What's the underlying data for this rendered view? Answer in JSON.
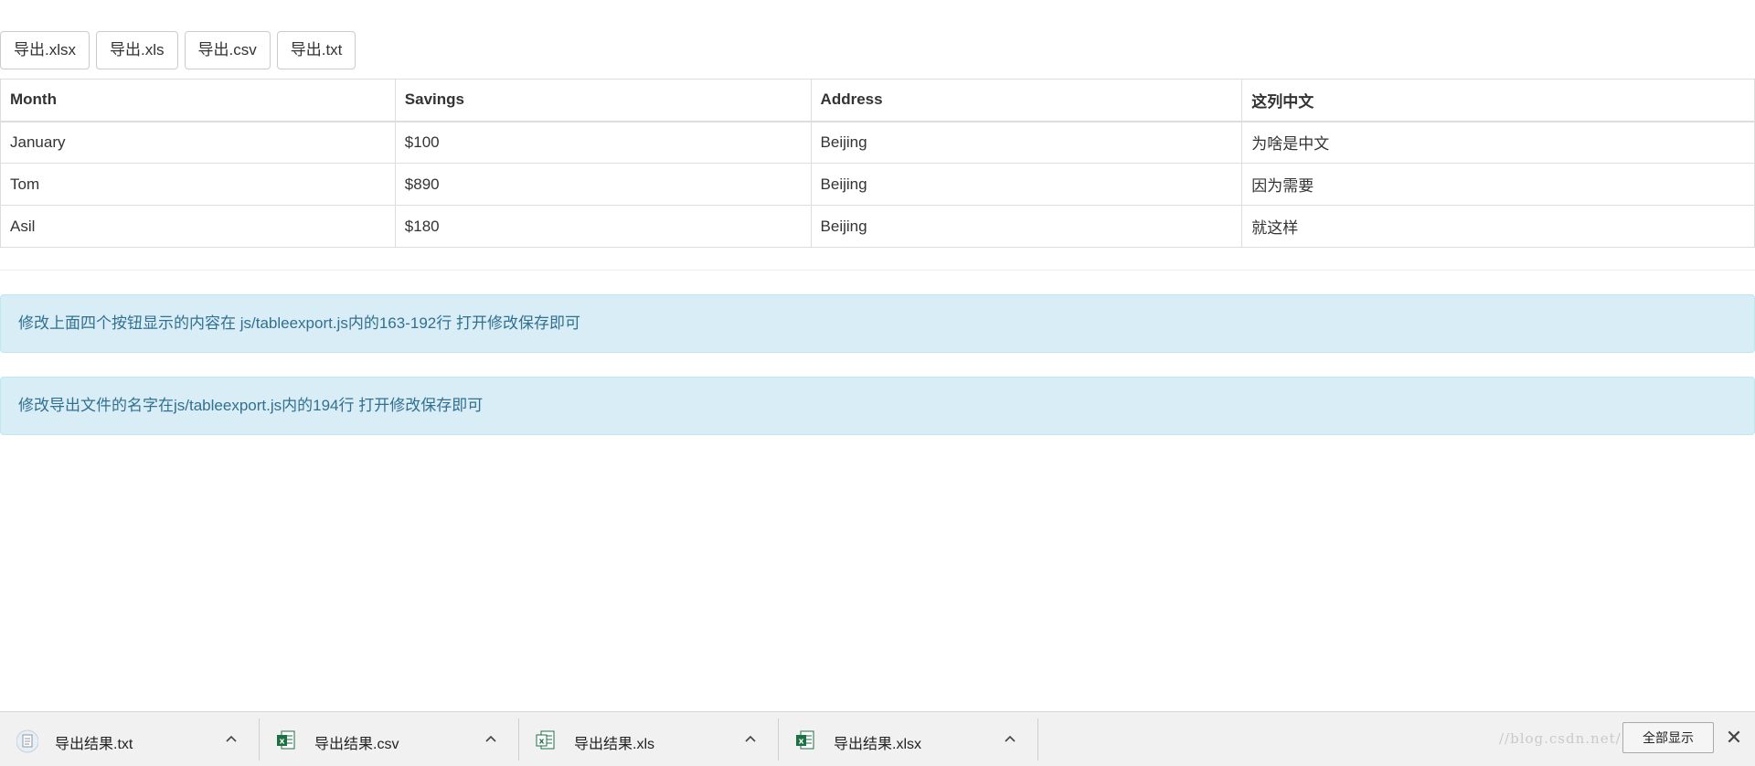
{
  "export_buttons": [
    "导出.xlsx",
    "导出.xls",
    "导出.csv",
    "导出.txt"
  ],
  "table": {
    "headers": [
      "Month",
      "Savings",
      "Address",
      "这列中文"
    ],
    "rows": [
      [
        "January",
        "$100",
        "Beijing",
        "为啥是中文"
      ],
      [
        "Tom",
        "$890",
        "Beijing",
        "因为需要"
      ],
      [
        "Asil",
        "$180",
        "Beijing",
        "就这样"
      ]
    ]
  },
  "alerts": [
    "修改上面四个按钮显示的内容在 js/tableexport.js内的163-192行 打开修改保存即可",
    "修改导出文件的名字在js/tableexport.js内的194行 打开修改保存即可"
  ],
  "download_bar": {
    "items": [
      {
        "name": "导出结果.txt",
        "icon": "text-file-icon"
      },
      {
        "name": "导出结果.csv",
        "icon": "excel-file-icon"
      },
      {
        "name": "导出结果.xls",
        "icon": "excel-file-icon"
      },
      {
        "name": "导出结果.xlsx",
        "icon": "excel-file-icon"
      }
    ],
    "show_all_label": "全部显示",
    "close_glyph": "✕",
    "watermark": "//blog.csdn.net/..."
  },
  "colors": {
    "alert_bg": "#d9edf7",
    "alert_text": "#31708f",
    "excel_green": "#1d7044"
  }
}
